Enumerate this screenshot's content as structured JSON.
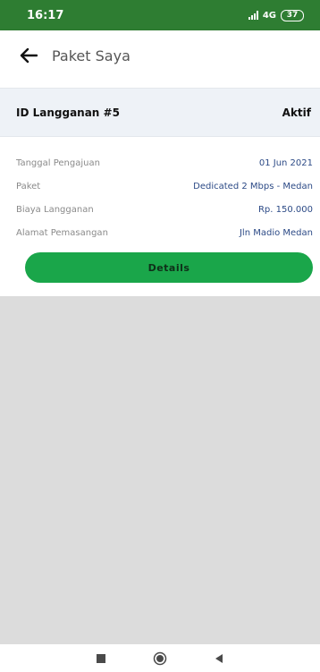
{
  "status_bar": {
    "time": "16:17",
    "network": "4G",
    "battery": "37"
  },
  "app_bar": {
    "title": "Paket Saya"
  },
  "subscription": {
    "id_label": "ID Langganan #5",
    "status": "Aktif",
    "details": [
      {
        "label": "Tanggal Pengajuan",
        "value": "01 Jun 2021"
      },
      {
        "label": "Paket",
        "value": "Dedicated 2 Mbps - Medan"
      },
      {
        "label": "Biaya Langganan",
        "value": "Rp. 150.000"
      },
      {
        "label": "Alamat Pemasangan",
        "value": "Jln Madio Medan"
      }
    ],
    "details_button_label": "Details"
  },
  "colors": {
    "status_bar": "#2e7d32",
    "accent": "#1aa64a",
    "value_text": "#2c4a86",
    "background": "#dcdcdc"
  },
  "icons": {
    "back": "arrow-left-icon",
    "signal": "signal-icon",
    "battery": "battery-icon",
    "nav_recent": "square-icon",
    "nav_home": "circle-icon",
    "nav_back": "triangle-back-icon"
  }
}
